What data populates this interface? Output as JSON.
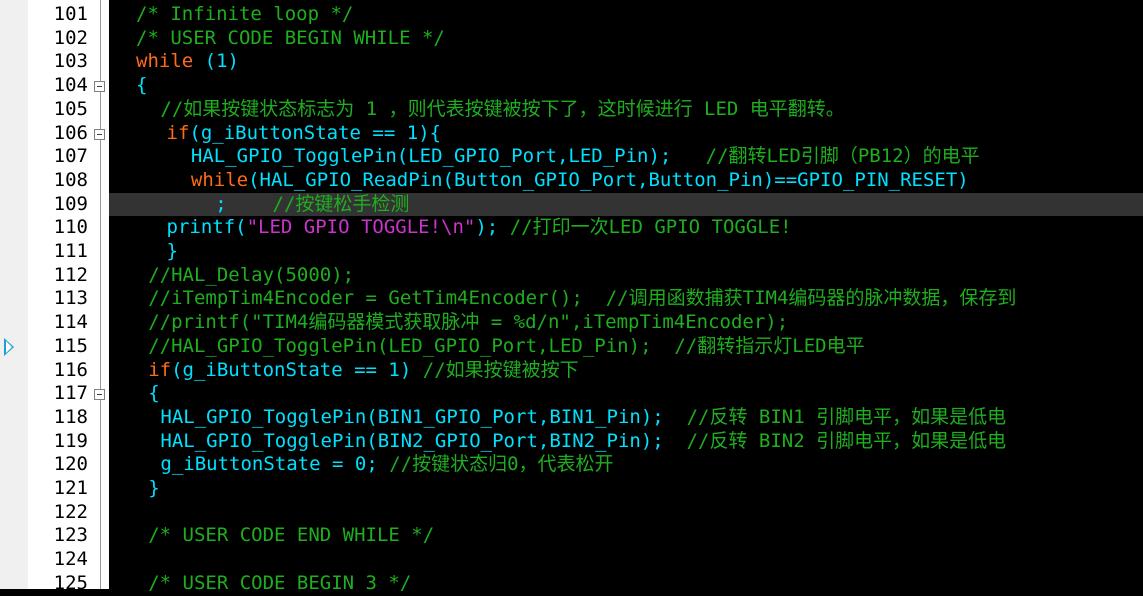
{
  "editor": {
    "highlight_line": 109,
    "lines": [
      {
        "n": "101",
        "fold": false,
        "indent": 0,
        "tokens": [
          {
            "t": "/* Infinite loop */",
            "c": "cm"
          }
        ]
      },
      {
        "n": "102",
        "fold": false,
        "indent": 0,
        "tokens": [
          {
            "t": "/* USER CODE BEGIN WHILE */",
            "c": "cm"
          }
        ]
      },
      {
        "n": "103",
        "fold": false,
        "indent": 0,
        "tokens": [
          {
            "t": "while",
            "c": "kw"
          },
          {
            "t": " (",
            "c": "fn"
          },
          {
            "t": "1",
            "c": "num"
          },
          {
            "t": ")",
            "c": "fn"
          }
        ]
      },
      {
        "n": "104",
        "fold": true,
        "indent": 0,
        "tokens": [
          {
            "t": "{",
            "c": "fn"
          }
        ]
      },
      {
        "n": "105",
        "fold": false,
        "indent": 4,
        "tokens": [
          {
            "t": "//如果按键状态标志为 1 ，则代表按键被按下了，这时候进行 LED 电平翻转。",
            "c": "cm"
          }
        ]
      },
      {
        "n": "106",
        "fold": true,
        "indent": 5,
        "tokens": [
          {
            "t": "if",
            "c": "kw"
          },
          {
            "t": "(g_iButtonState == ",
            "c": "fn"
          },
          {
            "t": "1",
            "c": "num"
          },
          {
            "t": "){",
            "c": "fn"
          }
        ]
      },
      {
        "n": "107",
        "fold": false,
        "indent": 9,
        "tokens": [
          {
            "t": "HAL_GPIO_TogglePin(LED_GPIO_Port,LED_Pin);   ",
            "c": "fn"
          },
          {
            "t": "//翻转LED引脚（PB12）的电平",
            "c": "cm"
          }
        ]
      },
      {
        "n": "108",
        "fold": false,
        "indent": 9,
        "tokens": [
          {
            "t": "while",
            "c": "kw"
          },
          {
            "t": "(HAL_GPIO_ReadPin(Button_GPIO_Port,Button_Pin)==GPIO_PIN_RESET)",
            "c": "fn"
          }
        ]
      },
      {
        "n": "109",
        "fold": false,
        "indent": 13,
        "tokens": [
          {
            "t": ";    ",
            "c": "fn"
          },
          {
            "t": "//按键松手检测",
            "c": "cm"
          }
        ]
      },
      {
        "n": "110",
        "fold": false,
        "indent": 5,
        "tokens": [
          {
            "t": "printf(",
            "c": "fn"
          },
          {
            "t": "\"LED GPIO TOGGLE!\\n\"",
            "c": "str"
          },
          {
            "t": "); ",
            "c": "fn"
          },
          {
            "t": "//打印一次LED GPIO TOGGLE!",
            "c": "cm"
          }
        ]
      },
      {
        "n": "111",
        "fold": false,
        "indent": 5,
        "tokens": [
          {
            "t": "}",
            "c": "fn"
          }
        ]
      },
      {
        "n": "112",
        "fold": false,
        "indent": 2,
        "tokens": [
          {
            "t": "//HAL_Delay(5000);",
            "c": "cm"
          }
        ]
      },
      {
        "n": "113",
        "fold": false,
        "indent": 2,
        "tokens": [
          {
            "t": "//iTempTim4Encoder = GetTim4Encoder();  //调用函数捕获TIM4编码器的脉冲数据，保存到",
            "c": "cm"
          }
        ]
      },
      {
        "n": "114",
        "fold": false,
        "indent": 2,
        "tokens": [
          {
            "t": "//printf(\"TIM4编码器模式获取脉冲 = %d/n\",iTempTim4Encoder);",
            "c": "cm"
          }
        ]
      },
      {
        "n": "115",
        "fold": false,
        "indent": 2,
        "tokens": [
          {
            "t": "//HAL_GPIO_TogglePin(LED_GPIO_Port,LED_Pin);  //翻转指示灯LED电平",
            "c": "cm"
          }
        ]
      },
      {
        "n": "116",
        "fold": false,
        "indent": 2,
        "tokens": [
          {
            "t": "if",
            "c": "kw"
          },
          {
            "t": "(g_iButtonState == ",
            "c": "fn"
          },
          {
            "t": "1",
            "c": "num"
          },
          {
            "t": ") ",
            "c": "fn"
          },
          {
            "t": "//如果按键被按下",
            "c": "cm"
          }
        ]
      },
      {
        "n": "117",
        "fold": true,
        "indent": 2,
        "tokens": [
          {
            "t": "{",
            "c": "fn"
          }
        ]
      },
      {
        "n": "118",
        "fold": false,
        "indent": 4,
        "tokens": [
          {
            "t": "HAL_GPIO_TogglePin(BIN1_GPIO_Port,BIN1_Pin);  ",
            "c": "fn"
          },
          {
            "t": "//反转 BIN1 引脚电平，如果是低电",
            "c": "cm"
          }
        ]
      },
      {
        "n": "119",
        "fold": false,
        "indent": 4,
        "tokens": [
          {
            "t": "HAL_GPIO_TogglePin(BIN2_GPIO_Port,BIN2_Pin);  ",
            "c": "fn"
          },
          {
            "t": "//反转 BIN2 引脚电平，如果是低电",
            "c": "cm"
          }
        ]
      },
      {
        "n": "120",
        "fold": false,
        "indent": 4,
        "tokens": [
          {
            "t": "g_iButtonState = ",
            "c": "fn"
          },
          {
            "t": "0",
            "c": "num"
          },
          {
            "t": "; ",
            "c": "fn"
          },
          {
            "t": "//按键状态归0，代表松开",
            "c": "cm"
          }
        ]
      },
      {
        "n": "121",
        "fold": false,
        "indent": 2,
        "tokens": [
          {
            "t": "}",
            "c": "fn"
          }
        ]
      },
      {
        "n": "122",
        "fold": false,
        "indent": 0,
        "tokens": []
      },
      {
        "n": "123",
        "fold": false,
        "indent": 2,
        "tokens": [
          {
            "t": "/* USER CODE END WHILE */",
            "c": "cm"
          }
        ]
      },
      {
        "n": "124",
        "fold": false,
        "indent": 0,
        "tokens": []
      },
      {
        "n": "125",
        "fold": false,
        "indent": 2,
        "tokens": [
          {
            "t": "/* USER CODE BEGIN 3 */",
            "c": "cm"
          }
        ]
      }
    ]
  },
  "colors": {
    "keyword": "#ff6a1a",
    "comment": "#1fae1f",
    "identifier": "#00e0ff",
    "string": "#cc33cc",
    "current_line": "#333333",
    "gutter": "#ffffff",
    "background": "#000000"
  },
  "icons": {
    "execution_marker": "play-triangle-icon",
    "fold_toggle": "minus-box-icon"
  }
}
